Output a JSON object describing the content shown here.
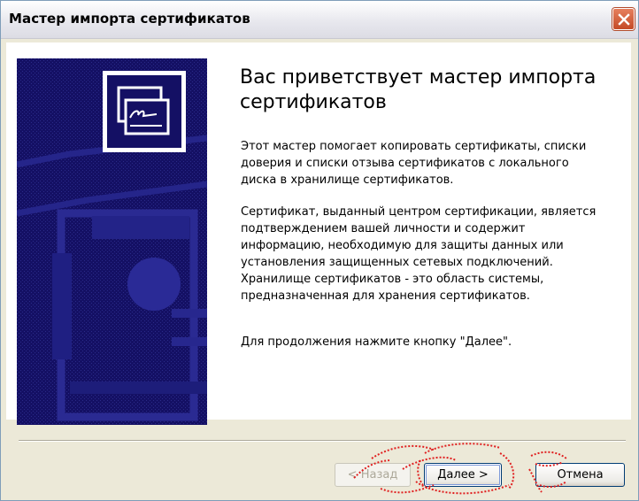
{
  "window": {
    "title": "Мастер импорта сертификатов",
    "close_icon": "close-icon",
    "accent_close": "#d2603b"
  },
  "banner": {
    "icon": "certificate-icon",
    "background": "#141064"
  },
  "main": {
    "heading": "Вас приветствует мастер импорта сертификатов",
    "paragraph1": "Этот мастер помогает копировать сертификаты, списки доверия и списки отзыва сертификатов с локального диска в хранилище сертификатов.",
    "paragraph2": "Сертификат, выданный центром сертификации, является подтверждением вашей личности и содержит информацию, необходимую для защиты данных или установления защищенных сетевых подключений. Хранилище сертификатов - это область системы, предназначенная для хранения сертификатов.",
    "paragraph3": "Для продолжения нажмите кнопку \"Далее\"."
  },
  "buttons": {
    "back_label": "< Назад",
    "next_label": "Далее >",
    "cancel_label": "Отмена"
  }
}
